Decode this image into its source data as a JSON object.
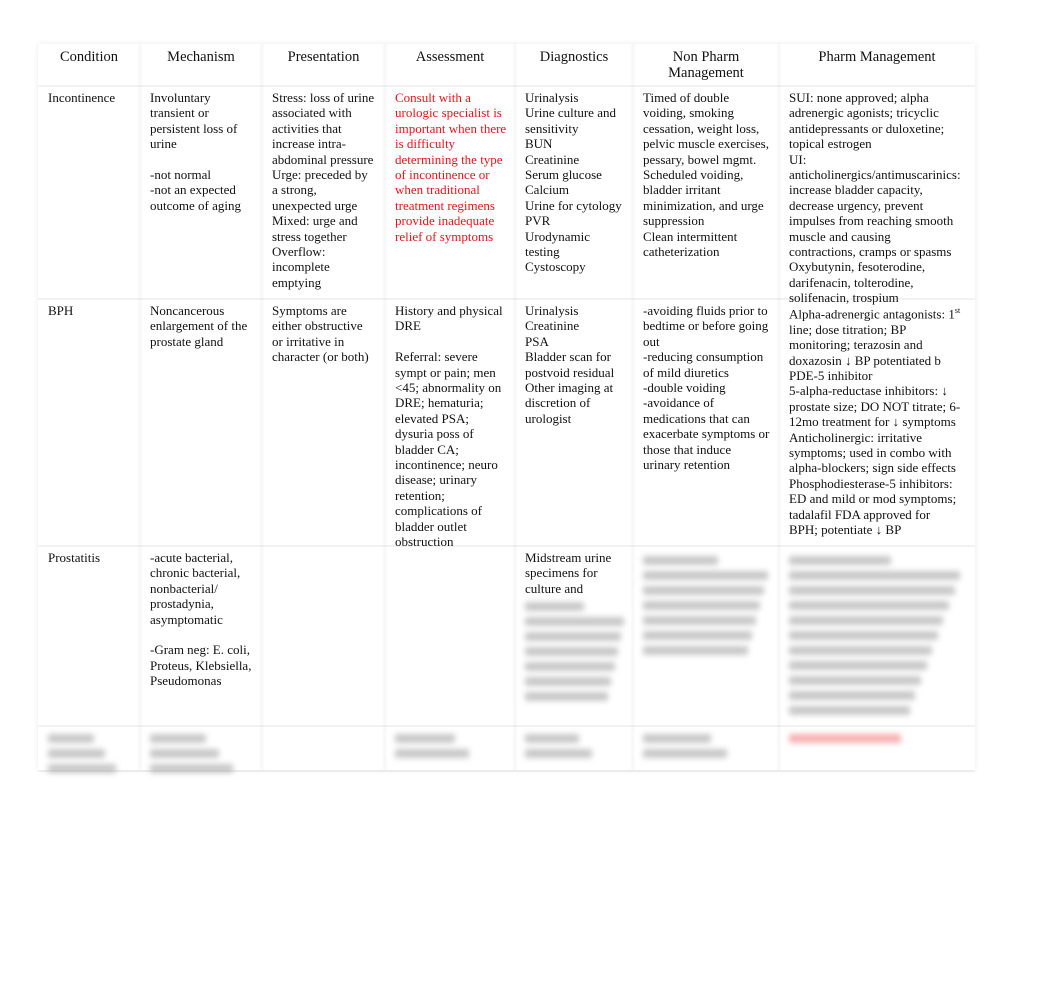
{
  "table": {
    "headers": [
      "Condition",
      "Mechanism",
      "Presentation",
      "Assessment",
      "Diagnostics",
      "Non Pharm\nManagement",
      "Pharm Management"
    ],
    "rows": [
      {
        "condition": [
          "Incontinence"
        ],
        "mechanism": [
          "Involuntary",
          "transient or",
          "persistent loss of",
          "urine",
          "",
          "-not normal",
          "-not an expected",
          "outcome of aging"
        ],
        "presentation": [
          "Stress: loss of urine",
          "associated with",
          "activities that",
          "increase intra-",
          "abdominal pressure",
          "Urge: preceded by",
          "a strong,",
          "unexpected urge",
          "Mixed: urge and",
          "stress together",
          "Overflow:",
          "incomplete",
          "emptying"
        ],
        "assessment": [
          "Consult with a",
          "urologic specialist is",
          "important when there",
          "is difficulty",
          "determining the type",
          "of incontinence or",
          "when traditional",
          "treatment regimens",
          "provide inadequate",
          "relief of symptoms"
        ],
        "assessment_color": "#e8141a",
        "diagnostics": [
          "Urinalysis",
          "Urine culture and",
          "sensitivity",
          "BUN",
          "Creatinine",
          "Serum glucose",
          "Calcium",
          "Urine for cytology",
          "PVR",
          "Urodynamic",
          "testing",
          "Cystoscopy"
        ],
        "nonpharm": [
          "Timed of double",
          "voiding, smoking",
          "cessation, weight loss,",
          "pelvic muscle exercises,",
          "pessary, bowel mgmt.",
          "Scheduled voiding,",
          "bladder irritant",
          "minimization, and urge",
          "suppression",
          "Clean intermittent",
          "catheterization"
        ],
        "pharm": [
          "SUI: none approved; alpha",
          "adrenergic agonists; tricyclic",
          "antidepressants or duloxetine;",
          "topical estrogen",
          "UI:",
          "anticholinergics/antimuscarinics:",
          "increase bladder capacity,",
          "decrease urgency, prevent",
          "impulses from reaching smooth",
          "muscle and causing",
          "contractions, cramps or spasms",
          "Oxybutynin, fesoterodine,",
          "darifenacin, tolterodine,",
          "solifenacin, trospium"
        ]
      },
      {
        "condition": [
          "BPH"
        ],
        "mechanism": [
          "Noncancerous",
          "enlargement of the",
          "prostate gland"
        ],
        "presentation": [
          "Symptoms are",
          "either obstructive",
          "or irritative in",
          "character (or both)"
        ],
        "assessment": [
          "History and physical",
          "DRE",
          "",
          "Referral: severe",
          "sympt or pain; men",
          "<45; abnormality on",
          "DRE; hematuria;",
          "elevated PSA;",
          "dysuria poss of",
          "bladder CA;",
          "incontinence; neuro",
          "disease; urinary",
          "retention;",
          "complications of",
          "bladder outlet",
          "obstruction"
        ],
        "diagnostics": [
          "Urinalysis",
          "Creatinine",
          "PSA",
          "Bladder scan for",
          "postvoid residual",
          "Other imaging at",
          "discretion of",
          "urologist"
        ],
        "nonpharm": [
          "-avoiding fluids prior to",
          "bedtime or before going",
          "out",
          "-reducing consumption",
          "of mild diuretics",
          "-double voiding",
          "-avoidance of",
          "medications that can",
          "exacerbate symptoms or",
          "those that induce",
          "urinary retention"
        ],
        "pharm": [
          "Alpha-adrenergic antagonists: 1",
          "line; dose titration; BP",
          "monitoring; terazosin and",
          "doxazosin ↓ BP potentiated b",
          "PDE-5 inhibitor",
          "5-alpha-reductase inhibitors: ↓",
          "prostate size; DO NOT titrate; 6-",
          "12mo treatment for ↓ symptoms",
          "Anticholinergic: irritative",
          "symptoms; used in combo with",
          "alpha-blockers; sign side effects",
          "Phosphodiesterase-5 inhibitors:",
          "ED and mild or mod symptoms;",
          "tadalafil FDA approved for",
          "BPH; potentiate ↓ BP"
        ],
        "pharm_sup": "st"
      },
      {
        "condition": [
          "Prostatitis"
        ],
        "mechanism": [
          "-acute bacterial,",
          "chronic bacterial,",
          "nonbacterial/",
          "prostadynia,",
          "asymptomatic",
          "",
          "-Gram neg: E. coli,",
          "Proteus, Klebsiella,",
          "Pseudomonas"
        ],
        "presentation": [],
        "assessment": [],
        "diagnostics": [
          "Midstream urine",
          "specimens for",
          "culture and"
        ]
      }
    ]
  }
}
